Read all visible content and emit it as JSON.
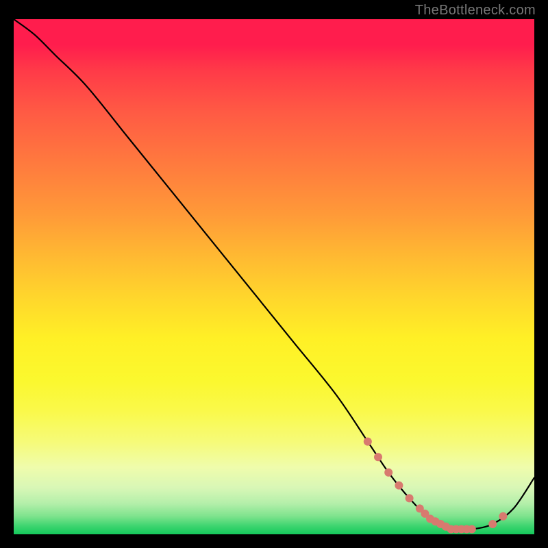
{
  "watermark": "TheBottleneck.com",
  "colors": {
    "dot": "#d87a6f",
    "line": "#000000"
  },
  "chart_data": {
    "type": "line",
    "title": "",
    "xlabel": "",
    "ylabel": "",
    "xlim": [
      0,
      100
    ],
    "ylim": [
      0,
      100
    ],
    "grid": false,
    "legend": false,
    "series": [
      {
        "name": "bottleneck-curve",
        "x": [
          0,
          4,
          8,
          14,
          22,
          30,
          38,
          46,
          54,
          62,
          68,
          72,
          76,
          80,
          84,
          88,
          92,
          96,
          100
        ],
        "values": [
          100,
          97,
          93,
          87,
          77,
          67,
          57,
          47,
          37,
          27,
          18,
          12,
          7,
          3,
          1,
          1,
          2,
          5,
          11
        ]
      }
    ],
    "highlight_dots_x": [
      68,
      70,
      72,
      74,
      76,
      78,
      79,
      80,
      81,
      82,
      83,
      84,
      85,
      86,
      87,
      88,
      92,
      94
    ]
  }
}
